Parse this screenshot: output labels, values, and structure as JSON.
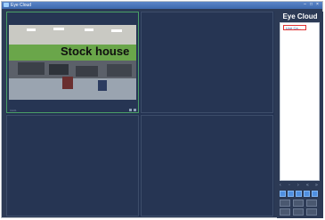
{
  "window": {
    "title": "Eye Cloud",
    "controls": [
      "–",
      "□",
      "×"
    ]
  },
  "sidebar": {
    "brand": "Eye Cloud",
    "device_item": "Live Ca...",
    "ptz_symbols": [
      "‹",
      "◦",
      "›",
      "«",
      "»"
    ],
    "control_labels": [
      "",
      "",
      "",
      "",
      "",
      ""
    ]
  },
  "video": {
    "overlay_text": "Stock house",
    "cell1_caption": "CH01"
  },
  "colors": {
    "accent": "#4a9f66",
    "button": "#4f8fe0",
    "background": "#2c3a55"
  }
}
